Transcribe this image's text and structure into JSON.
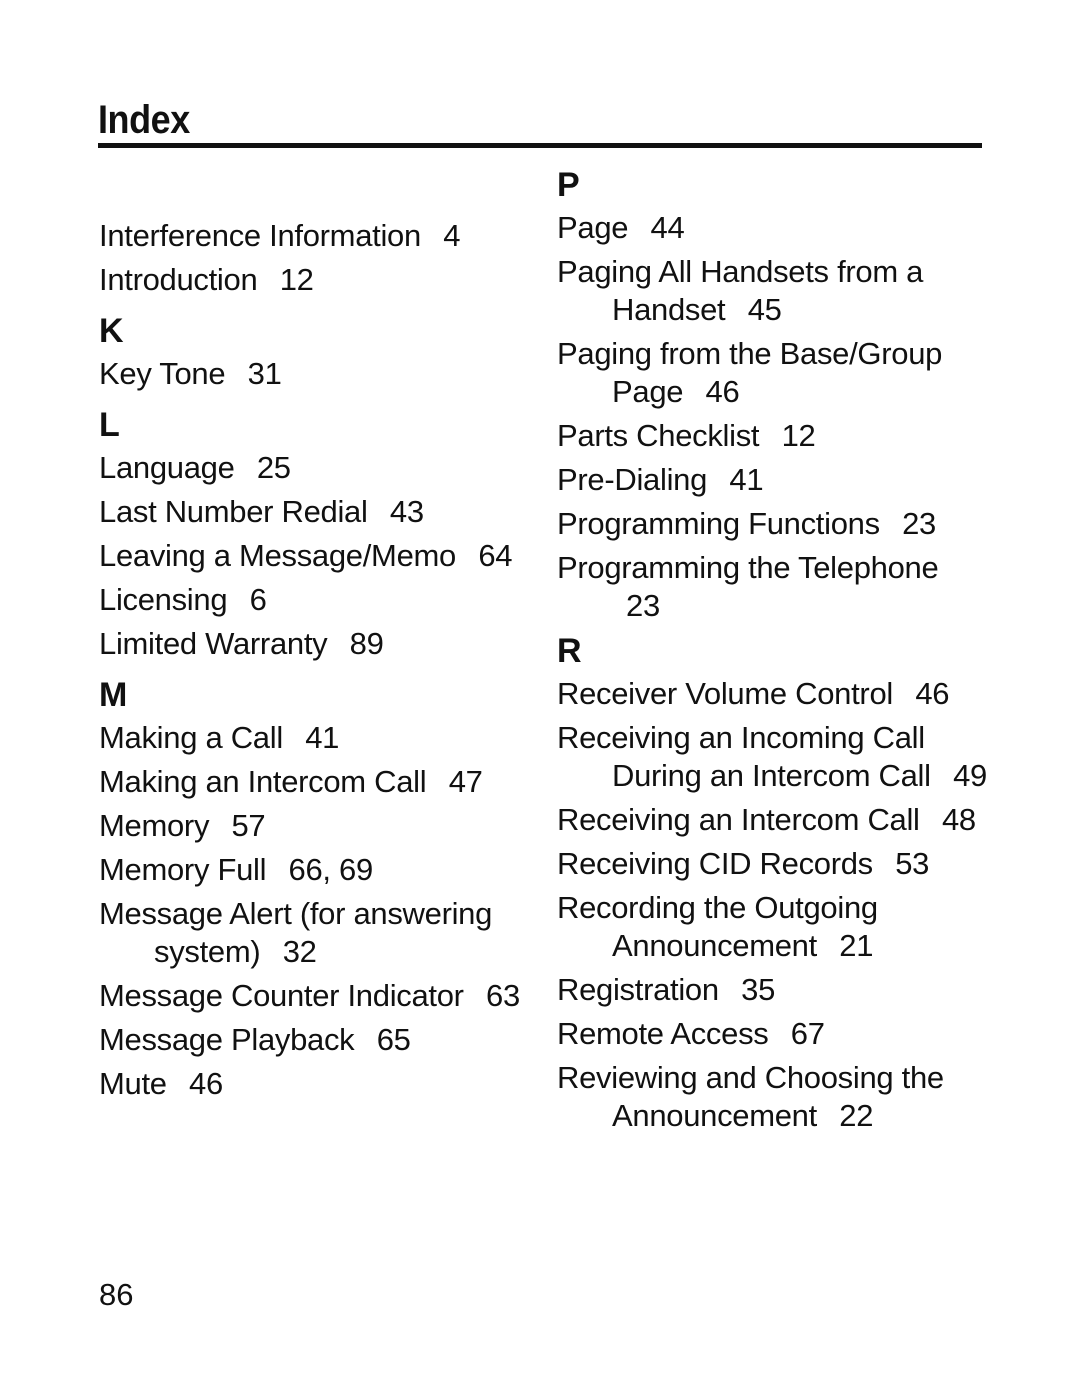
{
  "header": {
    "title": "Index"
  },
  "columns": {
    "left": {
      "continued_entries": [
        {
          "term": "Interference Information",
          "pages": "4"
        },
        {
          "term": "Introduction",
          "pages": "12"
        }
      ],
      "sections": [
        {
          "letter": "K",
          "entries": [
            {
              "term": "Key Tone",
              "pages": "31"
            }
          ]
        },
        {
          "letter": "L",
          "entries": [
            {
              "term": "Language",
              "pages": "25"
            },
            {
              "term": "Last Number Redial",
              "pages": "43"
            },
            {
              "term": "Leaving a Message/Memo",
              "pages": "64"
            },
            {
              "term": "Licensing",
              "pages": "6"
            },
            {
              "term": "Limited Warranty",
              "pages": "89"
            }
          ]
        },
        {
          "letter": "M",
          "entries": [
            {
              "term": "Making a Call",
              "pages": "41"
            },
            {
              "term": "Making an Intercom Call",
              "pages": "47"
            },
            {
              "term": "Memory",
              "pages": "57"
            },
            {
              "term": "Memory Full",
              "pages": "66, 69"
            },
            {
              "term": "Message Alert (for answering system)",
              "pages": "32"
            },
            {
              "term": "Message Counter Indicator",
              "pages": "63"
            },
            {
              "term": "Message Playback",
              "pages": "65"
            },
            {
              "term": "Mute",
              "pages": "46"
            }
          ]
        }
      ]
    },
    "right": {
      "sections": [
        {
          "letter": "P",
          "entries": [
            {
              "term": "Page",
              "pages": "44"
            },
            {
              "term": "Paging All Handsets from a Handset",
              "pages": "45"
            },
            {
              "term": "Paging from the Base/Group Page",
              "pages": "46"
            },
            {
              "term": "Parts Checklist",
              "pages": "12"
            },
            {
              "term": "Pre-Dialing",
              "pages": "41"
            },
            {
              "term": "Programming Functions",
              "pages": "23"
            },
            {
              "term": "Programming the Telephone",
              "pages": "23"
            }
          ]
        },
        {
          "letter": "R",
          "entries": [
            {
              "term": "Receiver Volume Control",
              "pages": "46"
            },
            {
              "term": "Receiving an Incoming Call During an Intercom Call",
              "pages": "49"
            },
            {
              "term": "Receiving an Intercom Call",
              "pages": "48"
            },
            {
              "term": "Receiving CID Records",
              "pages": "53"
            },
            {
              "term": "Recording the Outgoing Announcement",
              "pages": "21"
            },
            {
              "term": "Registration",
              "pages": "35"
            },
            {
              "term": "Remote Access",
              "pages": "67"
            },
            {
              "term": "Reviewing and Choosing the Announcement",
              "pages": "22"
            }
          ]
        }
      ]
    }
  },
  "footer": {
    "page_number": "86"
  }
}
